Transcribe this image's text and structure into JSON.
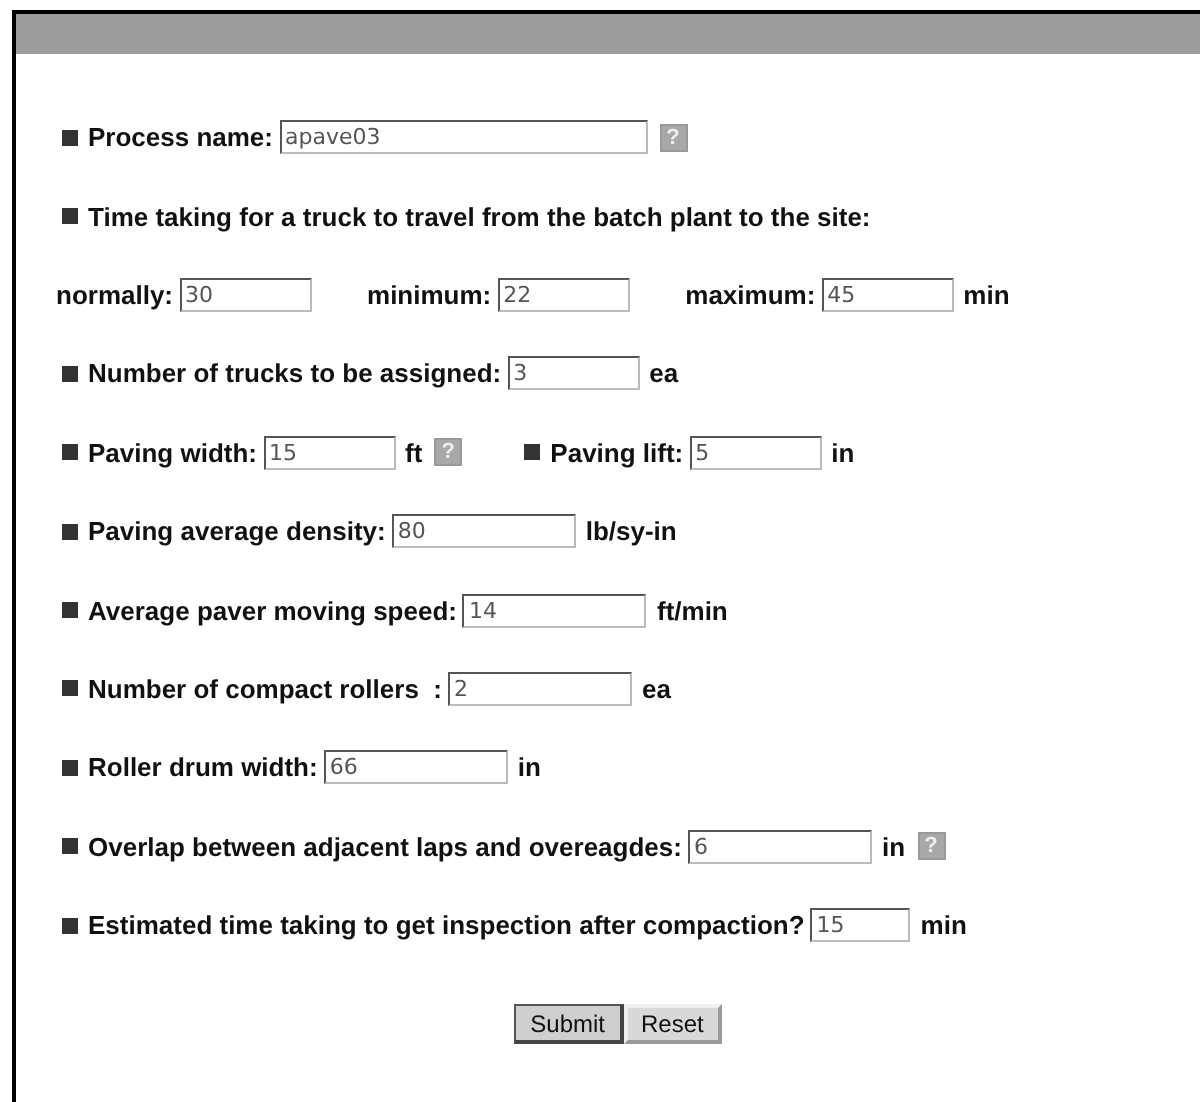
{
  "rows": [
    {
      "items": [
        {
          "kind": "bullet"
        },
        {
          "kind": "label",
          "text": "Process name:"
        },
        {
          "kind": "longfield",
          "value": "apave03"
        },
        {
          "kind": "help",
          "text": "?"
        }
      ]
    },
    {
      "items": [
        {
          "kind": "bullet"
        },
        {
          "kind": "label",
          "text": "Time taking for a truck to travel from the batch plant to the site:"
        }
      ]
    },
    {
      "items": [
        {
          "kind": "label",
          "text": "normally:"
        },
        {
          "kind": "field",
          "value": "30"
        },
        {
          "kind": "gap"
        },
        {
          "kind": "label",
          "text": "minimum:"
        },
        {
          "kind": "field",
          "value": "22"
        },
        {
          "kind": "gap"
        },
        {
          "kind": "label",
          "text": "maximum:"
        },
        {
          "kind": "field",
          "value": "45"
        },
        {
          "kind": "unit",
          "text": "min"
        }
      ]
    },
    {
      "items": [
        {
          "kind": "bullet"
        },
        {
          "kind": "label",
          "text": "Number of trucks to be assigned:"
        },
        {
          "kind": "field",
          "value": "3"
        },
        {
          "kind": "unit",
          "text": "ea"
        }
      ]
    },
    {
      "items": [
        {
          "kind": "bullet"
        },
        {
          "kind": "label",
          "text": "Paving width:"
        },
        {
          "kind": "field",
          "value": "15"
        },
        {
          "kind": "unit",
          "text": "ft"
        },
        {
          "kind": "help",
          "text": "?"
        },
        {
          "kind": "gap"
        },
        {
          "kind": "bullet"
        },
        {
          "kind": "label",
          "text": "Paving lift:"
        },
        {
          "kind": "field",
          "value": "5"
        },
        {
          "kind": "unit",
          "text": "in"
        }
      ]
    },
    {
      "items": [
        {
          "kind": "bullet"
        },
        {
          "kind": "label",
          "text": "Paving average density:"
        },
        {
          "kind": "widefield",
          "value": "80"
        },
        {
          "kind": "unit",
          "text": "lb/sy-in"
        }
      ]
    },
    {
      "items": [
        {
          "kind": "bullet"
        },
        {
          "kind": "label",
          "text": "Average paver moving speed:"
        },
        {
          "kind": "widefield",
          "value": "14"
        },
        {
          "kind": "unit",
          "text": "ft/min"
        }
      ]
    },
    {
      "items": [
        {
          "kind": "bullet"
        },
        {
          "kind": "label",
          "text": "Number of compact rollers  :"
        },
        {
          "kind": "widefield",
          "value": "2"
        },
        {
          "kind": "unit",
          "text": "ea"
        }
      ]
    },
    {
      "items": [
        {
          "kind": "bullet"
        },
        {
          "kind": "label",
          "text": "Roller drum width:"
        },
        {
          "kind": "widefield",
          "value": "66"
        },
        {
          "kind": "unit",
          "text": "in"
        }
      ]
    },
    {
      "items": [
        {
          "kind": "bullet"
        },
        {
          "kind": "label",
          "text": "Overlap between adjacent laps and overeagdes:"
        },
        {
          "kind": "widefield",
          "value": "6"
        },
        {
          "kind": "unit",
          "text": "in"
        },
        {
          "kind": "help",
          "text": "?"
        }
      ]
    },
    {
      "items": [
        {
          "kind": "bullet"
        },
        {
          "kind": "label",
          "text": "Estimated time taking to get inspection after compaction?"
        },
        {
          "kind": "narrowfield",
          "value": "15"
        },
        {
          "kind": "unit",
          "text": "min"
        }
      ]
    }
  ],
  "buttons": [
    {
      "label": "Submit",
      "kind": "submit"
    },
    {
      "label": "Reset",
      "kind": "reset"
    }
  ]
}
